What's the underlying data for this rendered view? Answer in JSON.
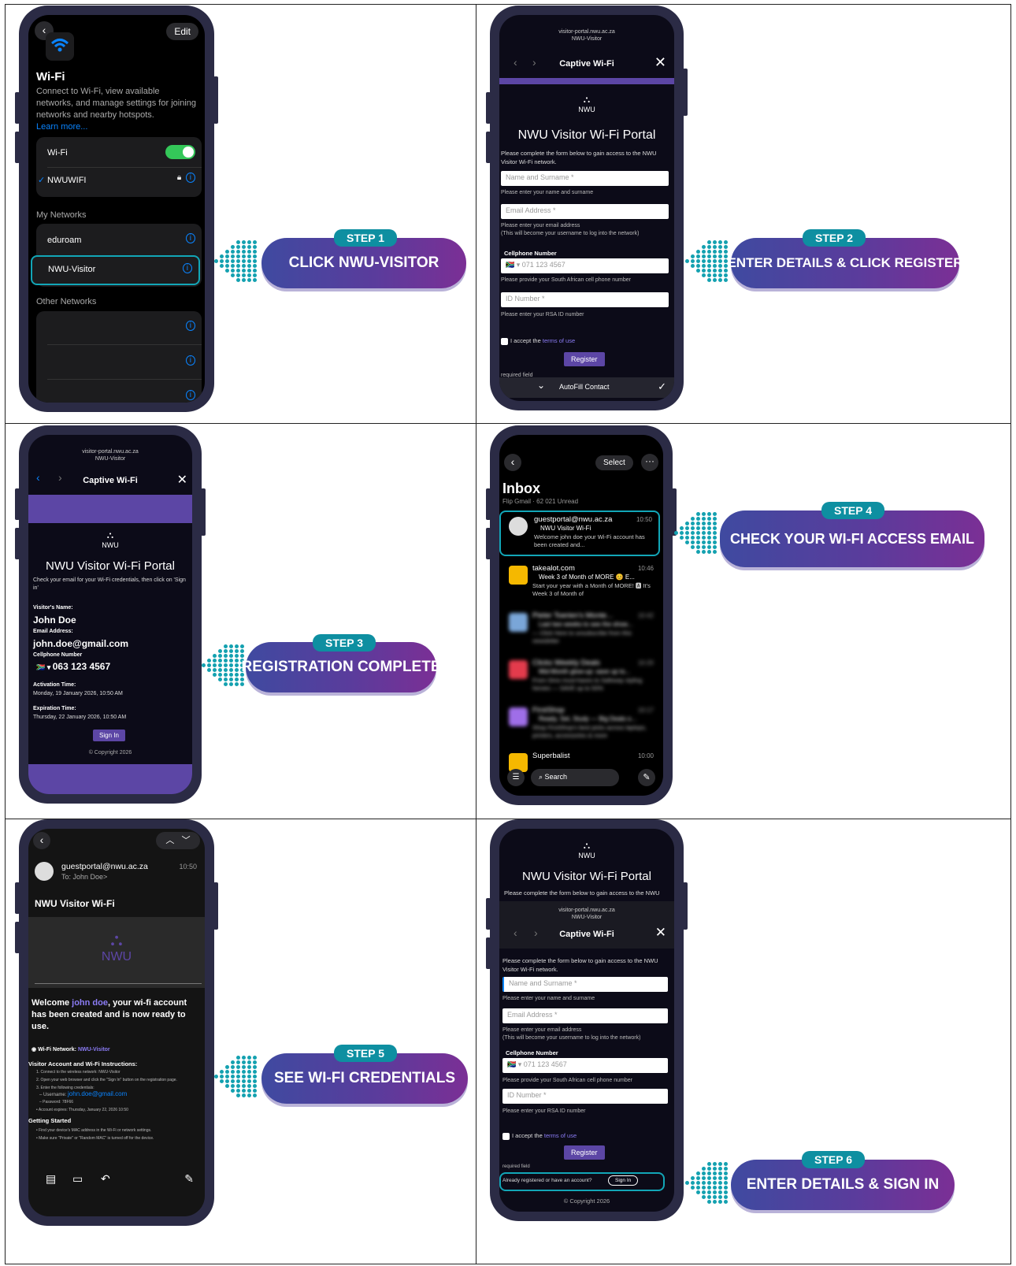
{
  "steps": [
    {
      "badge": "STEP 1",
      "label": "CLICK NWU-VISITOR"
    },
    {
      "badge": "STEP 2",
      "label": "ENTER DETAILS & CLICK REGISTER"
    },
    {
      "badge": "STEP 3",
      "label": "REGISTRATION COMPLETE"
    },
    {
      "badge": "STEP 4",
      "label": "CHECK YOUR WI-FI ACCESS EMAIL"
    },
    {
      "badge": "STEP 5",
      "label": "SEE WI-FI CREDENTIALS"
    },
    {
      "badge": "STEP 6",
      "label": "ENTER DETAILS & SIGN IN"
    }
  ],
  "wifi": {
    "edit": "Edit",
    "title": "Wi-Fi",
    "desc": "Connect to Wi-Fi, view available networks, and manage settings for joining networks and nearby hotspots.",
    "learn": "Learn more...",
    "toggle_label": "Wi-Fi",
    "connected": "NWUWIFI",
    "my_networks": "My Networks",
    "net1": "eduroam",
    "net2": "NWU-Visitor",
    "other_networks": "Other Networks"
  },
  "portal": {
    "url": "visitor-portal.nwu.ac.za",
    "url_sub": "NWU-Visitor",
    "tab_title": "Captive Wi-Fi",
    "logo": "NWU",
    "title": "NWU Visitor Wi-Fi Portal",
    "intro": "Please complete the form below to gain access to the NWU Visitor Wi-Fi network.",
    "name_ph": "Name and Surname *",
    "name_help": "Please enter your name and surname",
    "email_ph": "Email Address *",
    "email_help": "Please enter your email address",
    "email_help2": "(This will become your username to log into the network)",
    "cell_label": "Cellphone Number",
    "cell_ph": "071 123 4567",
    "cell_help": "Please provide your South African cell phone number",
    "id_ph": "ID Number *",
    "id_help": "Please enter your RSA ID number",
    "accept": "I accept the",
    "terms": "terms of use",
    "register": "Register",
    "required": "required field",
    "autofill": "AutoFill Contact",
    "already": "Already registered or have an account?",
    "signin": "Sign In",
    "copyright": "© Copyright 2026"
  },
  "complete": {
    "check": "Check your email for your Wi-Fi credentials, then click on 'Sign in'",
    "visitor_label": "Visitor's Name:",
    "visitor_name": "John Doe",
    "email_label": "Email Address:",
    "email": "john.doe@gmail.com",
    "cell_label": "Cellphone Number",
    "cell": "063 123 4567",
    "act_label": "Activation Time:",
    "act": "Monday, 19 January 2026, 10:50 AM",
    "exp_label": "Expiration Time:",
    "exp": "Thursday, 22 January 2026, 10:50 AM",
    "signin": "Sign In",
    "copyright": "© Copyright 2026"
  },
  "inbox": {
    "select": "Select",
    "title": "Inbox",
    "sub": "Flip Gmail · 62 021 Unread",
    "m1_from": "guestportal@nwu.ac.za",
    "m1_time": "10:50",
    "m1_subj": "NWU Visitor Wi-Fi",
    "m1_body": "Welcome john doe your Wi-Fi account has been created and...",
    "m2_from": "takealot.com",
    "m2_time": "10:46",
    "m2_subj": "Week 3 of Month of MORE 😊 E...",
    "m2_body": "Start your year with a Month of MORE! 🅰 It's Week 3 of Month of",
    "m3_from": "Pieter Toerien's Monte...",
    "m3_time": "10:42",
    "m3_subj": "Last two weeks to see the show...",
    "m3_body": "— Click Here to unsubscribe from this newsletter",
    "m4_from": "Clicks Weekly Deals",
    "m4_time": "10:20",
    "m4_subj": "Mid-Month glow-up: save up to...",
    "m4_body": "From Omo must-haves to Safeway styling heroes — SAVE up to 50%",
    "m5_from": "FirstShop",
    "m5_time": "10:17",
    "m5_subj": "Ready, Set, Study — Big Deals o...",
    "m5_body": "Shop FirstShop's best picks across laptops, printers, accessories & more",
    "m6_from": "Superbalist",
    "m6_time": "10:00",
    "search": "Search"
  },
  "email": {
    "from": "guestportal@nwu.ac.za",
    "time": "10:50",
    "to": "To: John Doe>",
    "subject": "NWU Visitor Wi-Fi",
    "logo": "NWU",
    "welcome_a": "Welcome ",
    "welcome_name": "john doe",
    "welcome_b": ", your wi-fi account has been created and is now ready to use.",
    "network_label": "Wi-Fi Network: ",
    "network": "NWU-Visitor",
    "instr_title": "Visitor Account and Wi-Fi Instructions:",
    "i1": "1. Connect to the wireless network: NWU-Visitor",
    "i2": "2. Open your web browser and click the \"Sign In\" button on the registration page.",
    "i3": "3. Enter the following credentials:",
    "username_label": "– Username: ",
    "username": "john.doe@gmail.com",
    "password": "– Password: 78F66",
    "expires": "• Account expires: Thursday, January 22, 2026 10:50",
    "getting": "Getting Started",
    "g1": "• Find your device's MAC address in the Wi-Fi or network settings.",
    "g2": "• Make sure \"Private\" or \"Random MAC\" is turned off for the device."
  },
  "colors": {
    "accent": "#0e8fa1",
    "purple": "#5c46a5",
    "ios_green": "#34c759",
    "ios_blue": "#0a84ff"
  }
}
